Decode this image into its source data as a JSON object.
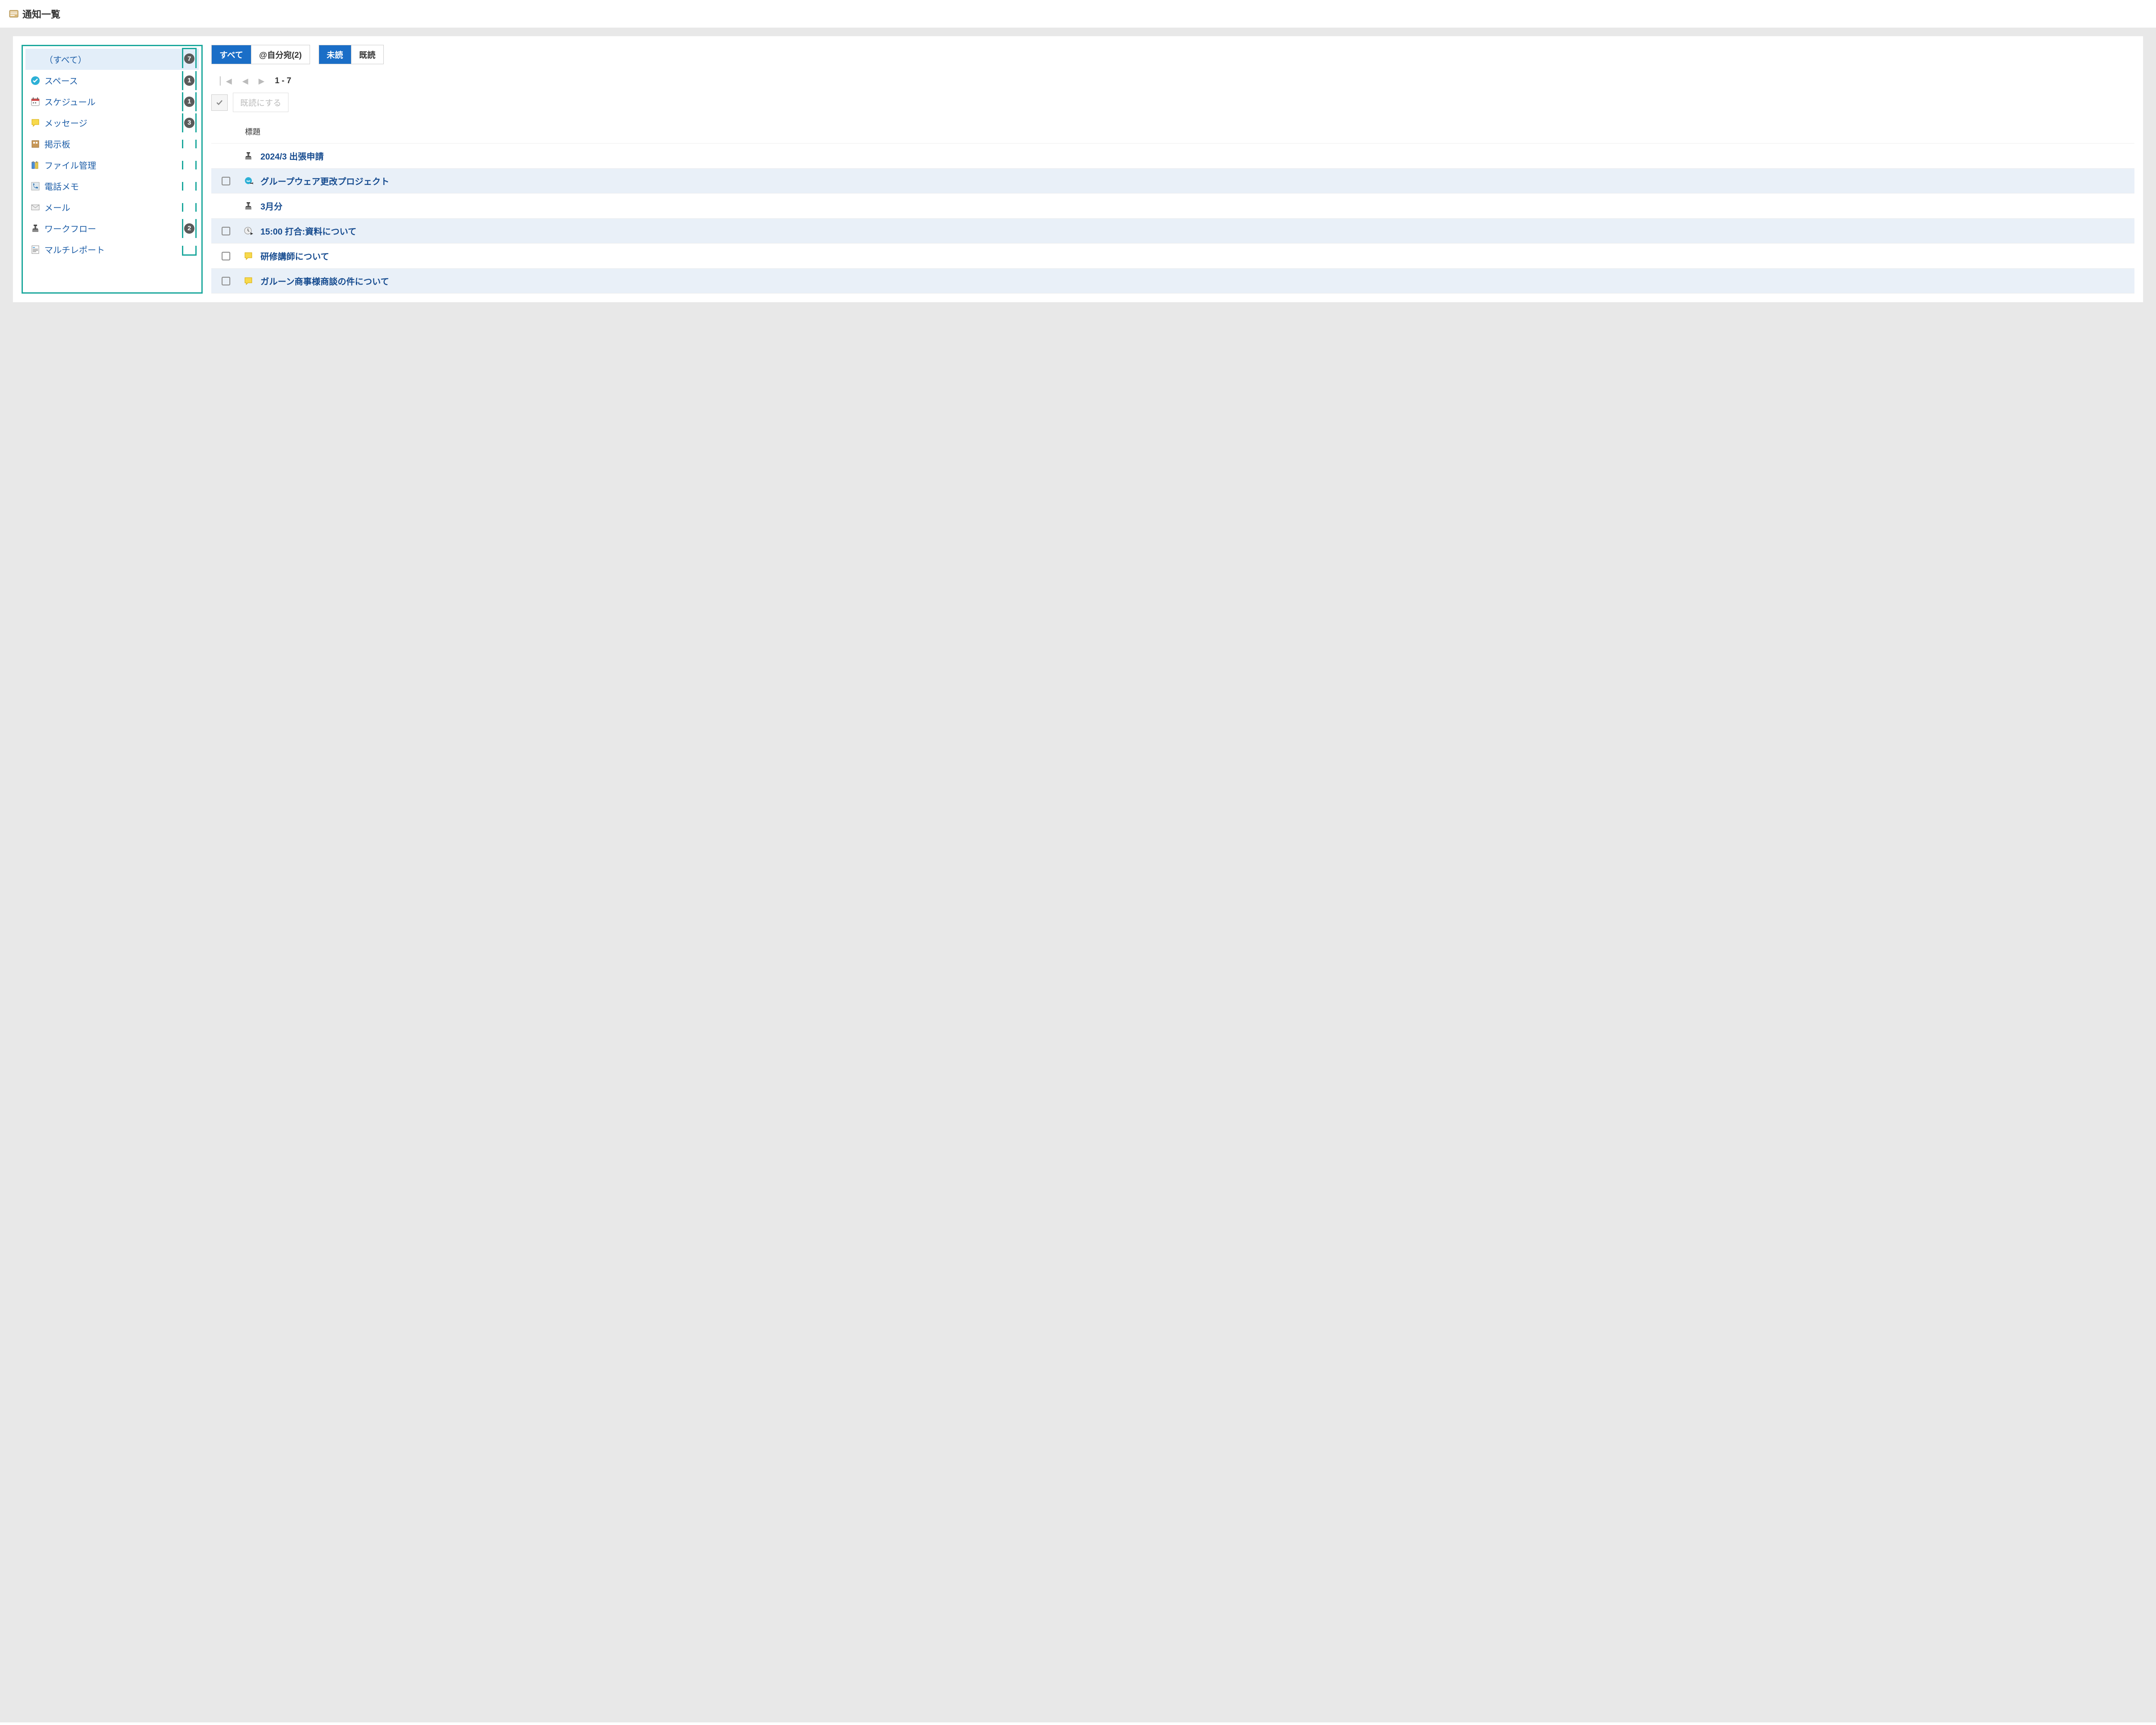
{
  "header": {
    "title": "通知一覧"
  },
  "sidebar": {
    "items": [
      {
        "label": "（すべて）",
        "count": "7",
        "icon": "none",
        "selected": true
      },
      {
        "label": "スペース",
        "count": "1",
        "icon": "space"
      },
      {
        "label": "スケジュール",
        "count": "1",
        "icon": "schedule"
      },
      {
        "label": "メッセージ",
        "count": "3",
        "icon": "message"
      },
      {
        "label": "掲示板",
        "count": "",
        "icon": "bulletin"
      },
      {
        "label": "ファイル管理",
        "count": "",
        "icon": "file"
      },
      {
        "label": "電話メモ",
        "count": "",
        "icon": "phone"
      },
      {
        "label": "メール",
        "count": "",
        "icon": "mail"
      },
      {
        "label": "ワークフロー",
        "count": "2",
        "icon": "workflow"
      },
      {
        "label": "マルチレポート",
        "count": "",
        "icon": "report"
      }
    ]
  },
  "tabs_filter": {
    "all": "すべて",
    "to_me": "@自分宛(2)"
  },
  "tabs_read": {
    "unread": "未読",
    "read": "既読"
  },
  "pagination": {
    "range": "1 - 7"
  },
  "toolbar": {
    "mark_read_label": "既読にする"
  },
  "table": {
    "header_title": "標題"
  },
  "notifications": [
    {
      "title": "2024/3 出張申請",
      "icon": "workflow",
      "checkbox": false,
      "alt": false
    },
    {
      "title": "グループウェア更改プロジェクト",
      "icon": "space",
      "checkbox": true,
      "alt": true
    },
    {
      "title": "3月分",
      "icon": "workflow",
      "checkbox": false,
      "alt": false
    },
    {
      "title": "15:00 打合:資料について",
      "icon": "schedule",
      "checkbox": true,
      "alt": true
    },
    {
      "title": "研修講師について",
      "icon": "message",
      "checkbox": true,
      "alt": false
    },
    {
      "title": "ガルーン商事様商談の件について",
      "icon": "message",
      "checkbox": true,
      "alt": true
    }
  ]
}
